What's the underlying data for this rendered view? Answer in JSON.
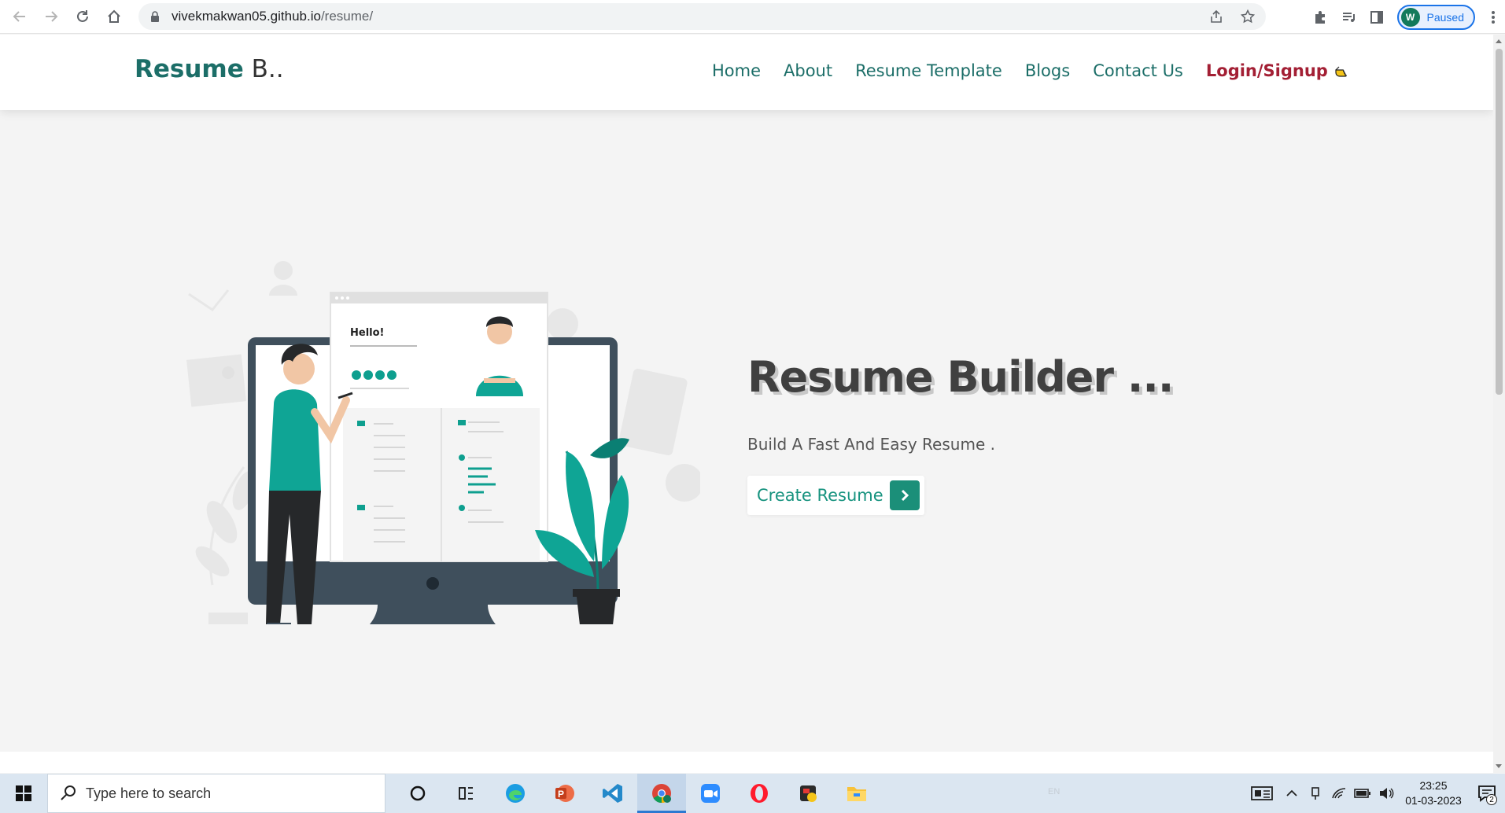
{
  "browser": {
    "url_host": "vivekmakwan05.github.io",
    "url_path": "/resume/",
    "profile_initial": "W",
    "profile_status": "Paused"
  },
  "site": {
    "logo_bold": "Resume",
    "logo_light": "B..",
    "nav": [
      {
        "label": "Home"
      },
      {
        "label": "About"
      },
      {
        "label": "Resume Template"
      },
      {
        "label": "Blogs"
      },
      {
        "label": "Contact Us"
      },
      {
        "label": "Login/Signup"
      }
    ]
  },
  "hero": {
    "title": "Resume Builder ...",
    "subtitle": "Build A Fast And Easy Resume .",
    "cta_label": "Create Resume",
    "illustration_greeting": "Hello!"
  },
  "taskbar": {
    "search_placeholder": "Type here to search",
    "language": "EN",
    "time": "23:25",
    "date": "01-03-2023",
    "notification_count": "2"
  },
  "colors": {
    "brand_teal": "#1c6e68",
    "accent_teal": "#17937f",
    "login_red": "#a31f34"
  }
}
